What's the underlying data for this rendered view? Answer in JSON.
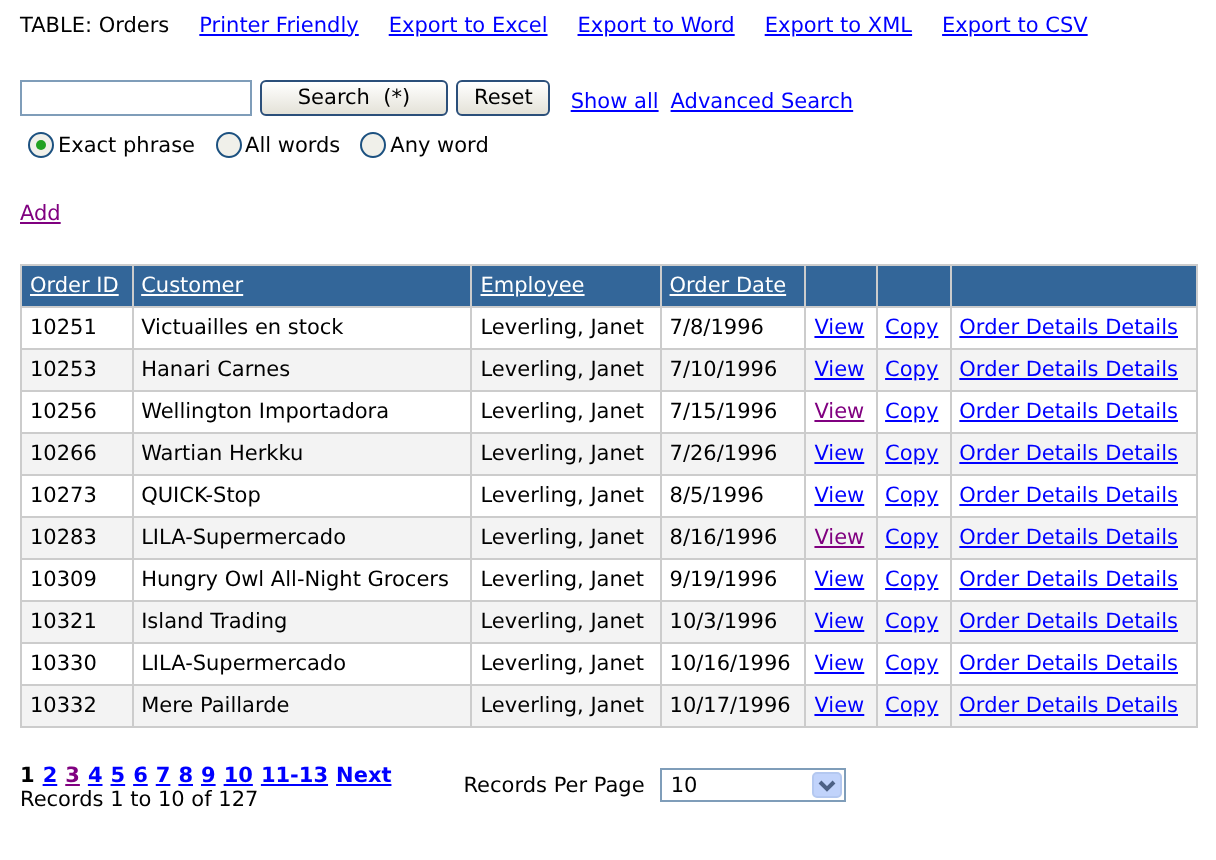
{
  "header": {
    "title": "TABLE: Orders",
    "links": [
      {
        "label": "Printer Friendly",
        "visited": false
      },
      {
        "label": "Export to Excel",
        "visited": false
      },
      {
        "label": "Export to Word",
        "visited": false
      },
      {
        "label": "Export to XML",
        "visited": false
      },
      {
        "label": "Export to CSV",
        "visited": false
      }
    ]
  },
  "search": {
    "search_button": "Search  (*)",
    "reset_button": "Reset",
    "links": [
      {
        "label": "Show all",
        "visited": false
      },
      {
        "label": "Advanced Search",
        "visited": false
      }
    ],
    "modes": [
      {
        "label": "Exact phrase",
        "selected": true
      },
      {
        "label": "All words",
        "selected": false
      },
      {
        "label": "Any word",
        "selected": false
      }
    ]
  },
  "add_link": {
    "label": "Add",
    "visited": true
  },
  "table": {
    "columns": [
      {
        "label": "Order ID"
      },
      {
        "label": "Customer"
      },
      {
        "label": "Employee"
      },
      {
        "label": "Order Date"
      },
      {},
      {},
      {}
    ],
    "rows": [
      {
        "order_id": "10251",
        "customer": "Victuailles en stock",
        "employee": "Leverling, Janet",
        "order_date": "7/8/1996",
        "view": {
          "label": "View",
          "visited": false
        },
        "copy": "Copy",
        "details": "Order Details Details"
      },
      {
        "order_id": "10253",
        "customer": "Hanari Carnes",
        "employee": "Leverling, Janet",
        "order_date": "7/10/1996",
        "view": {
          "label": "View",
          "visited": false
        },
        "copy": "Copy",
        "details": "Order Details Details"
      },
      {
        "order_id": "10256",
        "customer": "Wellington Importadora",
        "employee": "Leverling, Janet",
        "order_date": "7/15/1996",
        "view": {
          "label": "View",
          "visited": true
        },
        "copy": "Copy",
        "details": "Order Details Details"
      },
      {
        "order_id": "10266",
        "customer": "Wartian Herkku",
        "employee": "Leverling, Janet",
        "order_date": "7/26/1996",
        "view": {
          "label": "View",
          "visited": false
        },
        "copy": "Copy",
        "details": "Order Details Details"
      },
      {
        "order_id": "10273",
        "customer": "QUICK-Stop",
        "employee": "Leverling, Janet",
        "order_date": "8/5/1996",
        "view": {
          "label": "View",
          "visited": false
        },
        "copy": "Copy",
        "details": "Order Details Details"
      },
      {
        "order_id": "10283",
        "customer": "LILA-Supermercado",
        "employee": "Leverling, Janet",
        "order_date": "8/16/1996",
        "view": {
          "label": "View",
          "visited": true
        },
        "copy": "Copy",
        "details": "Order Details Details"
      },
      {
        "order_id": "10309",
        "customer": "Hungry Owl All-Night Grocers",
        "employee": "Leverling, Janet",
        "order_date": "9/19/1996",
        "view": {
          "label": "View",
          "visited": false
        },
        "copy": "Copy",
        "details": "Order Details Details"
      },
      {
        "order_id": "10321",
        "customer": "Island Trading",
        "employee": "Leverling, Janet",
        "order_date": "10/3/1996",
        "view": {
          "label": "View",
          "visited": false
        },
        "copy": "Copy",
        "details": "Order Details Details"
      },
      {
        "order_id": "10330",
        "customer": "LILA-Supermercado",
        "employee": "Leverling, Janet",
        "order_date": "10/16/1996",
        "view": {
          "label": "View",
          "visited": false
        },
        "copy": "Copy",
        "details": "Order Details Details"
      },
      {
        "order_id": "10332",
        "customer": "Mere Paillarde",
        "employee": "Leverling, Janet",
        "order_date": "10/17/1996",
        "view": {
          "label": "View",
          "visited": false
        },
        "copy": "Copy",
        "details": "Order Details Details"
      }
    ]
  },
  "pagination": {
    "pages": [
      {
        "label": "1",
        "selected": true
      },
      {
        "label": "2",
        "selected": false,
        "visited": false
      },
      {
        "label": "3",
        "selected": false,
        "visited": true
      },
      {
        "label": "4",
        "selected": false,
        "visited": false
      },
      {
        "label": "5",
        "selected": false,
        "visited": false
      },
      {
        "label": "6",
        "selected": false,
        "visited": false
      },
      {
        "label": "7",
        "selected": false,
        "visited": false
      },
      {
        "label": "8",
        "selected": false,
        "visited": false
      },
      {
        "label": "9",
        "selected": false,
        "visited": false
      },
      {
        "label": "10",
        "selected": false,
        "visited": false
      },
      {
        "label": "11-13",
        "selected": false,
        "visited": false
      },
      {
        "label": "Next",
        "selected": false,
        "visited": false
      }
    ],
    "summary": "Records 1 to 10 of 127",
    "per_page_label": "Records Per Page",
    "per_page_value": "10"
  }
}
